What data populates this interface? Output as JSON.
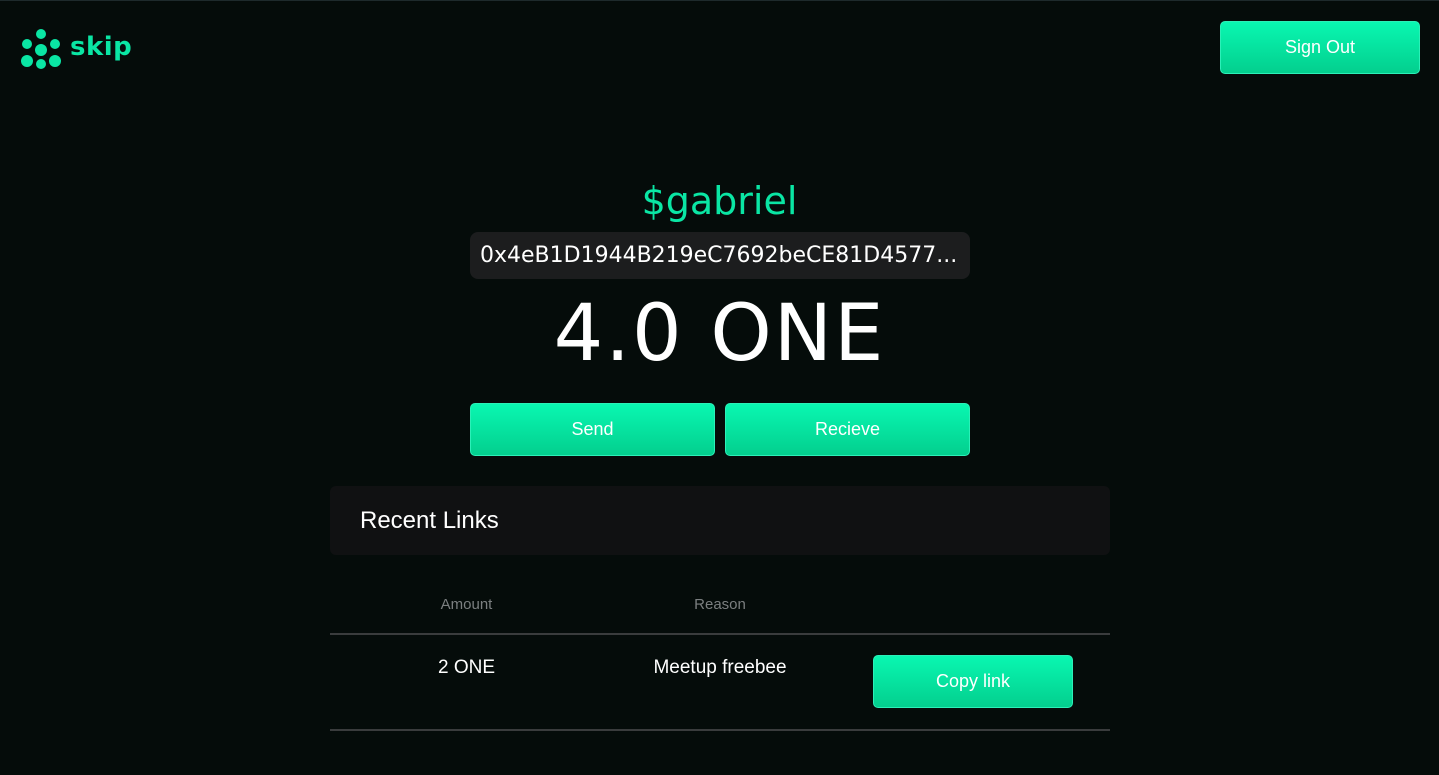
{
  "header": {
    "logo_text": "skip",
    "logo_icon": "people-cluster-icon",
    "signout_label": "Sign Out"
  },
  "wallet": {
    "username": "$gabriel",
    "address": "0x4eB1D1944B219eC7692beCE81D4577...",
    "balance": "4.0 ONE",
    "send_label": "Send",
    "receive_label": "Recieve"
  },
  "recent_links": {
    "title": "Recent Links",
    "columns": [
      "Amount",
      "Reason"
    ],
    "rows": [
      {
        "amount": "2 ONE",
        "reason": "Meetup freebee",
        "action_label": "Copy link"
      }
    ]
  },
  "colors": {
    "background": "#050c0a",
    "accent": "#0ae6a4",
    "button_top": "#09f7b1",
    "button_bottom": "#03cf8e",
    "card": "#101112",
    "address_bg": "#1c1d1e"
  }
}
